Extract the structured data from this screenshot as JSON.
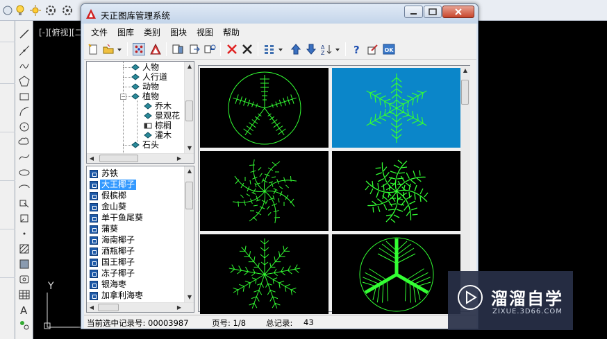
{
  "cad": {
    "view_label": "[-][俯视][二",
    "ucs_label": "Y"
  },
  "dialog": {
    "title": "天正图库管理系统",
    "menu": [
      "文件",
      "图库",
      "类别",
      "图块",
      "视图",
      "帮助"
    ],
    "toolbar_icons": [
      "new-icon",
      "open-icon",
      "dropdown-arrow-icon",
      "select-all-icon",
      "triangle-icon",
      "import-icon",
      "export-icon",
      "replace-icon",
      "delete-red-icon",
      "delete-icon",
      "grid-view-icon",
      "dropdown-arrow-icon",
      "up-arrow-icon",
      "down-arrow-icon",
      "sort-icon",
      "dropdown-arrow-icon",
      "help-icon",
      "edit-icon",
      "ok-icon"
    ],
    "ok_label": "OK"
  },
  "tree": {
    "items": [
      {
        "label": "人物",
        "level": 1
      },
      {
        "label": "人行道",
        "level": 1
      },
      {
        "label": "动物",
        "level": 1
      },
      {
        "label": "植物",
        "level": 1,
        "expanded": true
      },
      {
        "label": "乔木",
        "level": 2
      },
      {
        "label": "景观花",
        "level": 2
      },
      {
        "label": "棕榈",
        "level": 2,
        "open": true
      },
      {
        "label": "灌木",
        "level": 2
      },
      {
        "label": "石头",
        "level": 1
      }
    ]
  },
  "list": {
    "items": [
      "苏铁",
      "大王椰子",
      "假槟榔",
      "金山葵",
      "单干鱼尾葵",
      "蒲葵",
      "海南椰子",
      "酒瓶椰子",
      "国王椰子",
      "冻子椰子",
      "银海枣",
      "加拿利海枣"
    ],
    "selected_index": 1
  },
  "preview": {
    "cells": [
      {
        "name": "palm-symbol-1",
        "selected": false
      },
      {
        "name": "palm-symbol-2",
        "selected": true
      },
      {
        "name": "palm-symbol-3",
        "selected": false
      },
      {
        "name": "palm-symbol-4",
        "selected": false
      },
      {
        "name": "palm-symbol-5",
        "selected": false
      },
      {
        "name": "palm-symbol-6",
        "selected": false
      }
    ],
    "stroke_color": "#33ff33"
  },
  "status": {
    "record_label": "当前选中记录号: 00003987",
    "page_label": "页号: 1/8",
    "total_label": "总记录:",
    "total_value": "43"
  },
  "watermark": {
    "text": "溜溜自学",
    "sub": "ZIXUE.3D66.COM"
  }
}
